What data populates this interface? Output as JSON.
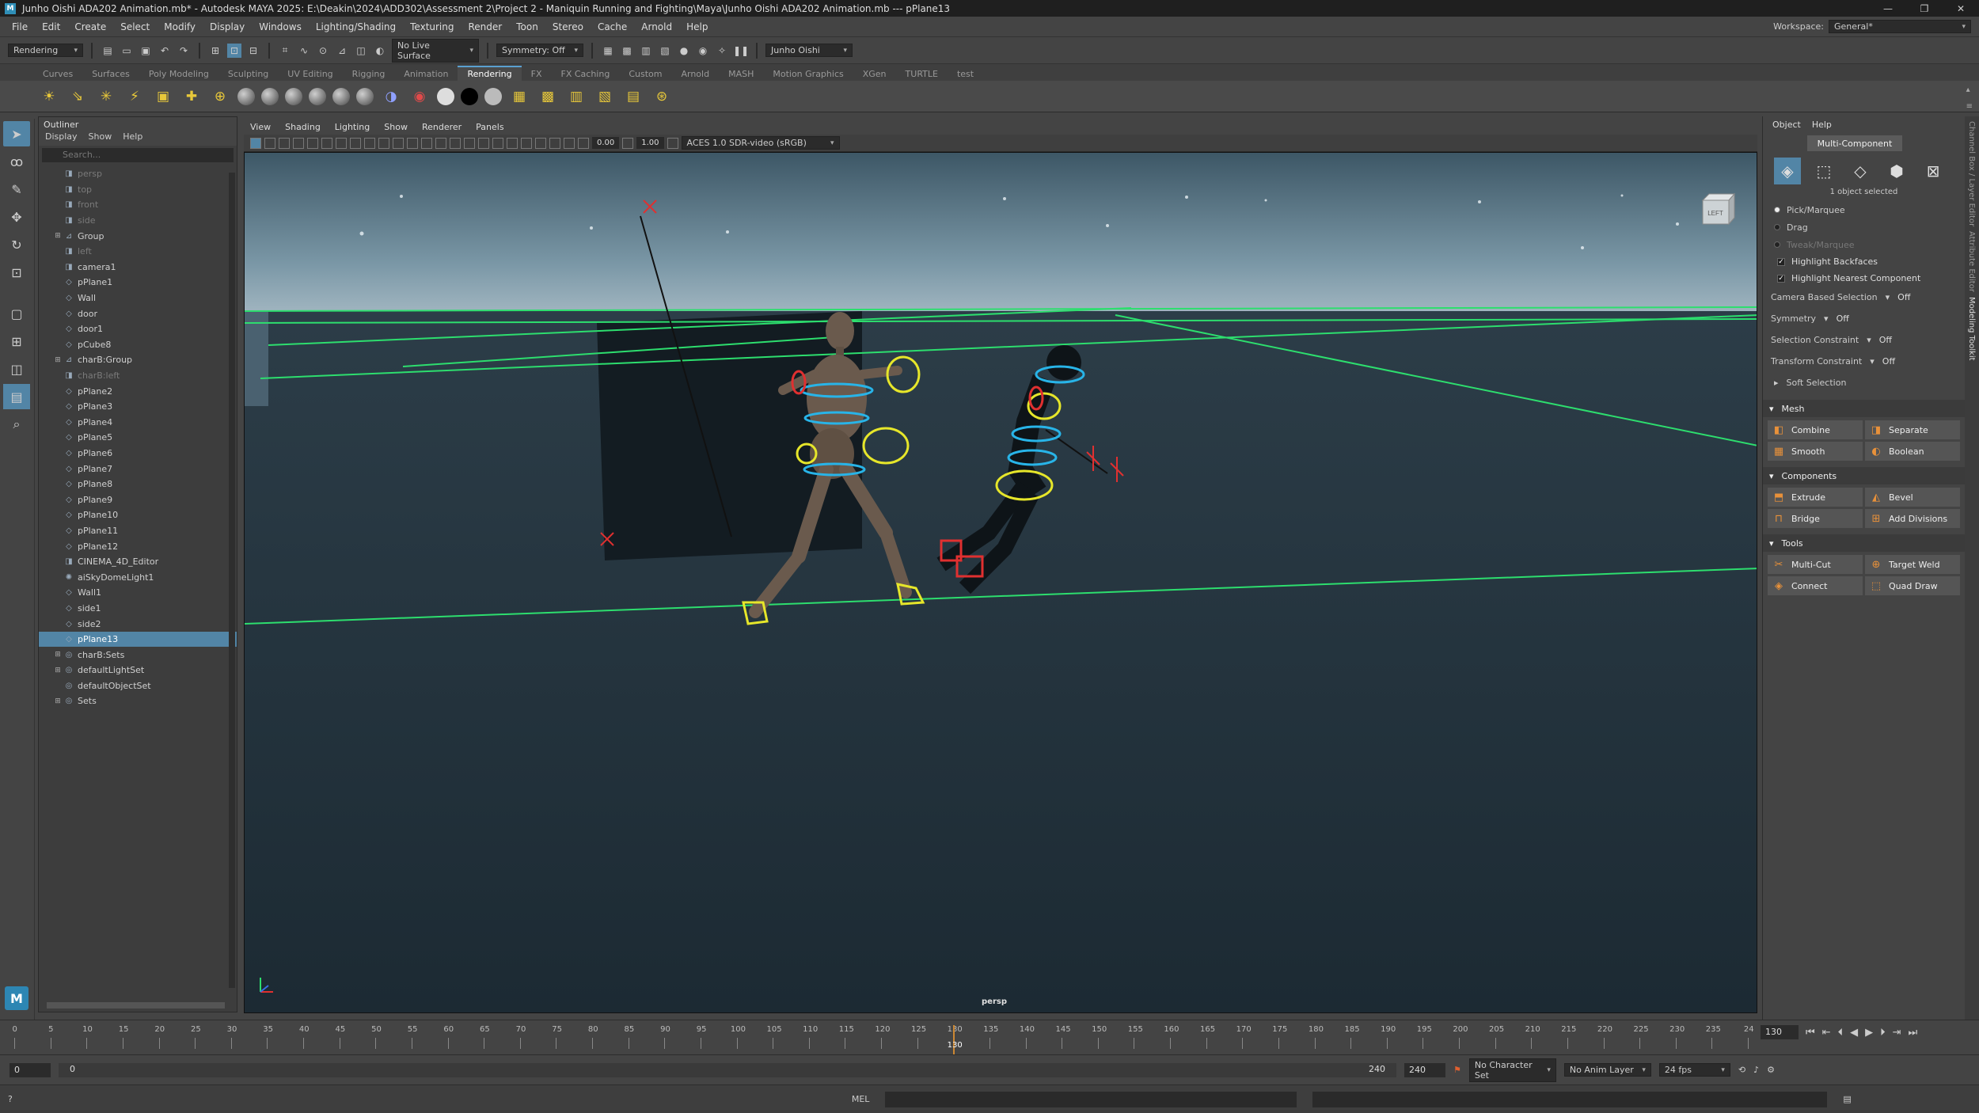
{
  "window": {
    "title": "Junho Oishi ADA202 Animation.mb* - Autodesk MAYA 2025: E:\\Deakin\\2024\\ADD302\\Assessment 2\\Project 2 - Maniquin Running and Fighting\\Maya\\Junho Oishi ADA202 Animation.mb  ---  pPlane13",
    "logo": "M",
    "minimize": "—",
    "maximize": "❐",
    "close": "✕"
  },
  "menubar": {
    "items": [
      "File",
      "Edit",
      "Create",
      "Select",
      "Modify",
      "Display",
      "Windows",
      "Lighting/Shading",
      "Texturing",
      "Render",
      "Toon",
      "Stereo",
      "Cache",
      "Arnold",
      "Help"
    ],
    "workspace_label": "Workspace:",
    "workspace_value": "General*"
  },
  "statusline": {
    "mode": "Rendering",
    "live_surface": "No Live Surface",
    "symmetry": "Symmetry: Off",
    "user": "Junho Oishi"
  },
  "shelf": {
    "tabs": [
      "Curves",
      "Surfaces",
      "Poly Modeling",
      "Sculpting",
      "UV Editing",
      "Rigging",
      "Animation",
      "Rendering",
      "FX",
      "FX Caching",
      "Custom",
      "Arnold",
      "MASH",
      "Motion Graphics",
      "XGen",
      "TURTLE",
      "test"
    ],
    "active_tab": "Rendering"
  },
  "outliner": {
    "title": "Outliner",
    "menu": [
      "Display",
      "Show",
      "Help"
    ],
    "search_placeholder": "Search...",
    "items": [
      {
        "label": "persp",
        "icon": "camera-icon",
        "dim": true
      },
      {
        "label": "top",
        "icon": "camera-icon",
        "dim": true
      },
      {
        "label": "front",
        "icon": "camera-icon",
        "dim": true
      },
      {
        "label": "side",
        "icon": "camera-icon",
        "dim": true
      },
      {
        "label": "Group",
        "icon": "group-icon",
        "expand": true
      },
      {
        "label": "left",
        "icon": "camera-icon",
        "dim": true
      },
      {
        "label": "camera1",
        "icon": "camera-icon"
      },
      {
        "label": "pPlane1",
        "icon": "mesh-icon"
      },
      {
        "label": "Wall",
        "icon": "mesh-icon"
      },
      {
        "label": "door",
        "icon": "mesh-icon"
      },
      {
        "label": "door1",
        "icon": "mesh-icon"
      },
      {
        "label": "pCube8",
        "icon": "mesh-icon"
      },
      {
        "label": "charB:Group",
        "icon": "group-icon",
        "expand": true
      },
      {
        "label": "charB:left",
        "icon": "camera-icon",
        "dim": true
      },
      {
        "label": "pPlane2",
        "icon": "mesh-icon"
      },
      {
        "label": "pPlane3",
        "icon": "mesh-icon"
      },
      {
        "label": "pPlane4",
        "icon": "mesh-icon"
      },
      {
        "label": "pPlane5",
        "icon": "mesh-icon"
      },
      {
        "label": "pPlane6",
        "icon": "mesh-icon"
      },
      {
        "label": "pPlane7",
        "icon": "mesh-icon"
      },
      {
        "label": "pPlane8",
        "icon": "mesh-icon"
      },
      {
        "label": "pPlane9",
        "icon": "mesh-icon"
      },
      {
        "label": "pPlane10",
        "icon": "mesh-icon"
      },
      {
        "label": "pPlane11",
        "icon": "mesh-icon"
      },
      {
        "label": "pPlane12",
        "icon": "mesh-icon"
      },
      {
        "label": "CINEMA_4D_Editor",
        "icon": "camera-icon"
      },
      {
        "label": "aiSkyDomeLight1",
        "icon": "light-icon"
      },
      {
        "label": "Wall1",
        "icon": "mesh-icon"
      },
      {
        "label": "side1",
        "icon": "mesh-icon"
      },
      {
        "label": "side2",
        "icon": "mesh-icon"
      },
      {
        "label": "pPlane13",
        "icon": "mesh-icon",
        "selected": true
      },
      {
        "label": "charB:Sets",
        "icon": "set-icon",
        "expand": true
      },
      {
        "label": "defaultLightSet",
        "icon": "set-icon",
        "expand": true
      },
      {
        "label": "defaultObjectSet",
        "icon": "set-icon"
      },
      {
        "label": "Sets",
        "icon": "set-icon",
        "expand": true
      }
    ]
  },
  "viewport": {
    "menu": [
      "View",
      "Shading",
      "Lighting",
      "Show",
      "Renderer",
      "Panels"
    ],
    "value1": "0.00",
    "value2": "1.00",
    "color_space": "ACES 1.0 SDR-video (sRGB)",
    "camera_label": "persp",
    "viewcube_label": "LEFT"
  },
  "modeling_toolkit": {
    "menu": [
      "Object",
      "Help"
    ],
    "mode_button": "Multi-Component",
    "selection_status": "1 object selected",
    "pick_options": [
      {
        "label": "Pick/Marquee",
        "on": true
      },
      {
        "label": "Drag",
        "on": false
      },
      {
        "label": "Tweak/Marquee",
        "on": false,
        "dim": true
      }
    ],
    "checks": [
      "Highlight Backfaces",
      "Highlight Nearest Component"
    ],
    "options": [
      {
        "label": "Camera Based Selection",
        "value": "Off"
      },
      {
        "label": "Symmetry",
        "value": "Off"
      },
      {
        "label": "Selection Constraint",
        "value": "Off"
      },
      {
        "label": "Transform Constraint",
        "value": "Off"
      }
    ],
    "soft_selection": "Soft Selection",
    "sections": [
      {
        "title": "Mesh",
        "buttons": [
          "Combine",
          "Separate",
          "Smooth",
          "Boolean"
        ]
      },
      {
        "title": "Components",
        "buttons": [
          "Extrude",
          "Bevel",
          "Bridge",
          "Add Divisions"
        ]
      },
      {
        "title": "Tools",
        "buttons": [
          "Multi-Cut",
          "Target Weld",
          "Connect",
          "Quad Draw"
        ]
      }
    ],
    "side_tabs": [
      "Channel Box / Layer Editor",
      "Attribute Editor",
      "Modeling Toolkit"
    ]
  },
  "timeline": {
    "labels": [
      "0",
      "5",
      "10",
      "15",
      "20",
      "25",
      "30",
      "35",
      "40",
      "45",
      "50",
      "55",
      "60",
      "65",
      "70",
      "75",
      "80",
      "85",
      "90",
      "95",
      "100",
      "105",
      "110",
      "115",
      "120",
      "125",
      "130",
      "135",
      "140",
      "145",
      "150",
      "155",
      "160",
      "165",
      "170",
      "175",
      "180",
      "185",
      "190",
      "195",
      "200",
      "205",
      "210",
      "215",
      "220",
      "225",
      "230",
      "235",
      "24"
    ],
    "current_frame": "130",
    "current_frame_field": "130"
  },
  "range": {
    "start": "0",
    "inner_start": "0",
    "inner_end": "240",
    "end": "240",
    "character_set": "No Character Set",
    "anim_layer": "No Anim Layer",
    "fps": "24 fps"
  },
  "command_line": {
    "label": "MEL"
  },
  "colors": {
    "accent": "#5285a6",
    "grid_line": "#2dde6e",
    "viewport_bg": "#1e2b34"
  }
}
